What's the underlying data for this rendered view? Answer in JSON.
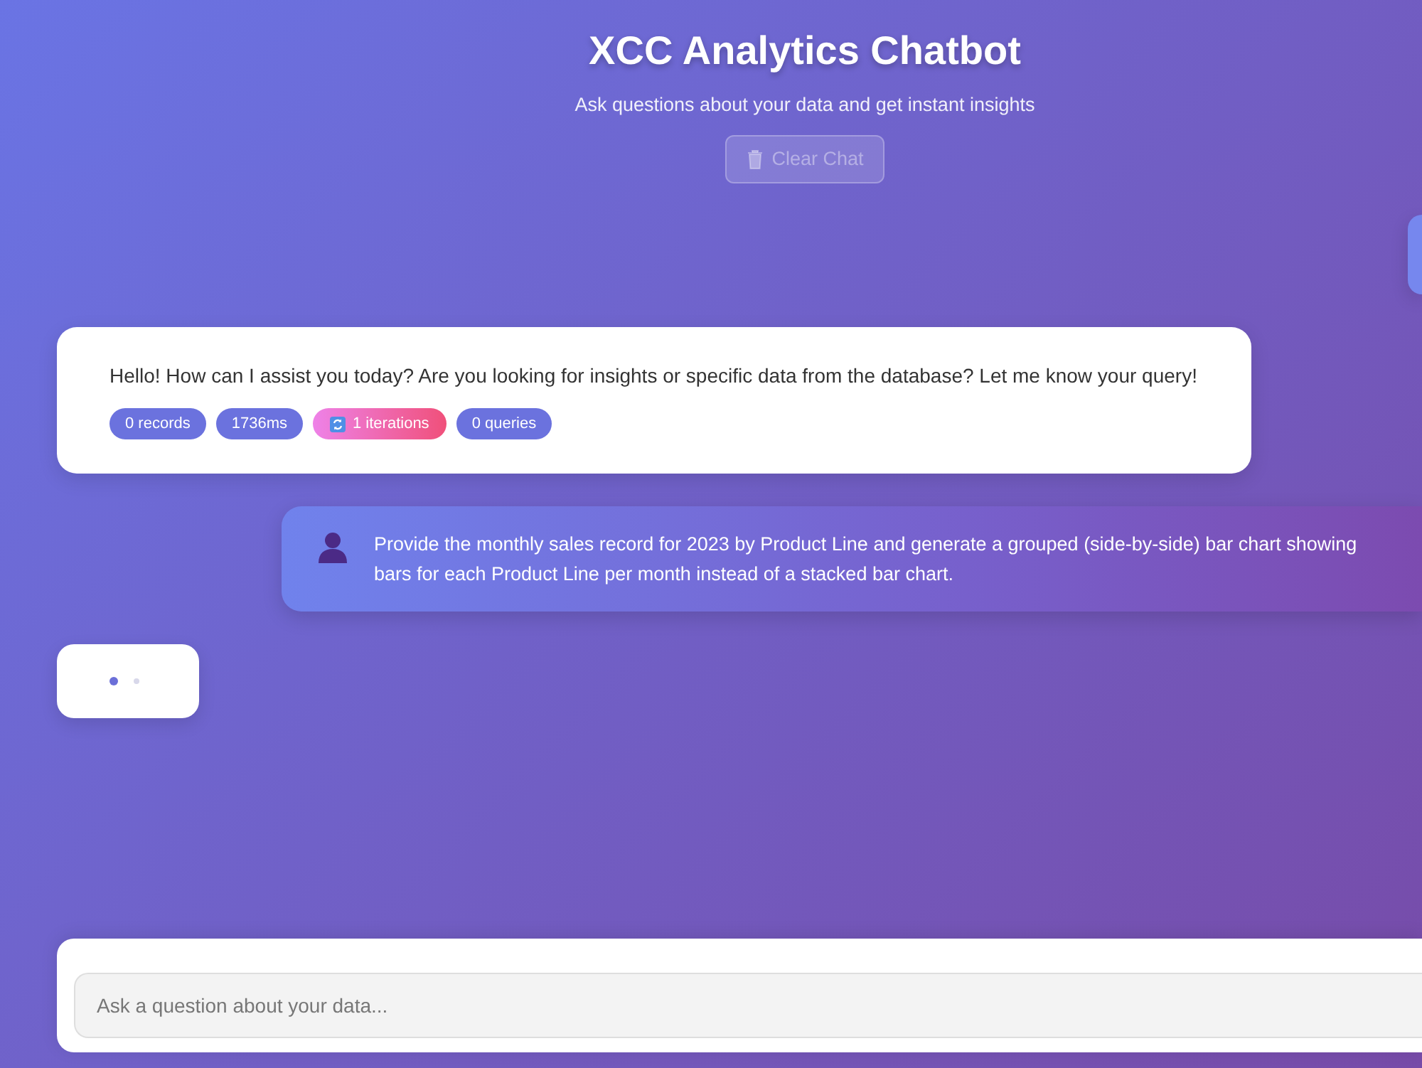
{
  "header": {
    "title": "XCC Analytics Chatbot",
    "subtitle": "Ask questions about your data and get instant insights",
    "clear_button": {
      "label": "Clear Chat",
      "disabled": true
    }
  },
  "messages": [
    {
      "kind": "user_partial"
    },
    {
      "kind": "assistant",
      "text": "Hello! How can I assist you today? Are you looking for insights or specific data from the database? Let me know your query!",
      "badges": [
        {
          "kind": "metric",
          "label": "0 records"
        },
        {
          "kind": "metric",
          "label": "1736ms"
        },
        {
          "kind": "iterations",
          "label": "1 iterations"
        },
        {
          "kind": "metric",
          "label": "0 queries"
        }
      ]
    },
    {
      "kind": "user",
      "text": "Provide the monthly sales record for 2023 by Product Line and generate a grouped (side-by-side) bar chart showing bars for each Product Line per month instead of a stacked bar chart."
    },
    {
      "kind": "typing"
    }
  ],
  "input": {
    "placeholder": "Ask a question about your data..."
  }
}
